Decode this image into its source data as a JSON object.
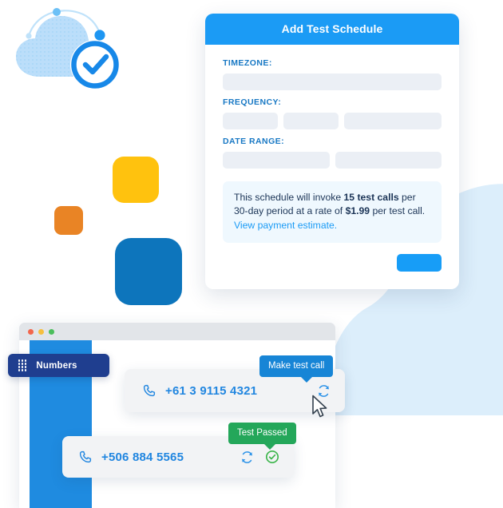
{
  "theme": {
    "primary_blue": "#1B9BF5",
    "dark_blue": "#1F3E8F",
    "sidebar_blue": "#1F8BE0",
    "success_green": "#24A75A",
    "yellow_square": "#FFC20E",
    "orange_square": "#E98425",
    "blue_square": "#0D75BC",
    "label_blue": "#1878C4",
    "info_bg": "#EFF8FE",
    "input_bg": "#EBEFF5"
  },
  "logo": {
    "name": "cloud-check-logo",
    "cloud_icon": "cloud-icon",
    "check_icon": "check-circle-icon"
  },
  "dialog": {
    "title": "Add Test Schedule",
    "fields": [
      {
        "label": "TIMEZONE:",
        "name": "timezone",
        "inputs": [
          {
            "name": "timezone-input",
            "value": "",
            "placeholder": ""
          }
        ]
      },
      {
        "label": "FREQUENCY:",
        "name": "frequency",
        "inputs": [
          {
            "name": "frequency-count-input",
            "value": "",
            "placeholder": ""
          },
          {
            "name": "frequency-unit-input",
            "value": "",
            "placeholder": ""
          },
          {
            "name": "frequency-period-input",
            "value": "",
            "placeholder": ""
          }
        ]
      },
      {
        "label": "DATE RANGE:",
        "name": "date-range",
        "inputs": [
          {
            "name": "date-range-start-input",
            "value": "",
            "placeholder": ""
          },
          {
            "name": "date-range-end-input",
            "value": "",
            "placeholder": ""
          }
        ]
      }
    ],
    "info": {
      "part1": "This schedule will invoke ",
      "calls": "15 test calls",
      "part2": " per 30-day period at a rate of ",
      "rate": "$1.99",
      "part3": " per test call. ",
      "link": "View payment estimate."
    },
    "submit_label": ""
  },
  "browser": {
    "traffic_lights": [
      "red",
      "yellow",
      "green"
    ],
    "sidebar_item": {
      "label": "Numbers",
      "icon": "dialpad-icon"
    }
  },
  "phone_rows": [
    {
      "name": "phone-row-au",
      "number": "+61 3 9115 4321",
      "phone_icon": "phone-icon",
      "actions": [
        {
          "name": "make-test-call-button",
          "icon": "refresh-icon"
        }
      ],
      "tooltip": "Make test call"
    },
    {
      "name": "phone-row-cr",
      "number": "+506 884 5565",
      "phone_icon": "phone-icon",
      "actions": [
        {
          "name": "make-test-call-button",
          "icon": "refresh-icon"
        },
        {
          "name": "test-status-indicator",
          "icon": "check-circle-icon"
        }
      ],
      "tooltip": "Test Passed"
    }
  ],
  "cursor": {
    "name": "mouse-cursor",
    "icon": "cursor-arrow-icon"
  },
  "decorations": {
    "square_yellow": "yellow-rounded-square",
    "square_orange": "orange-rounded-square",
    "square_blue": "blue-rounded-square",
    "blob": "background-blob-shape"
  }
}
